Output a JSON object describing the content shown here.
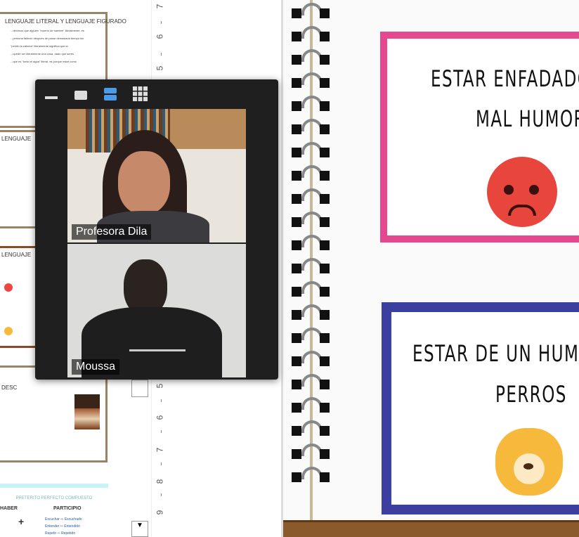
{
  "document": {
    "slide1_title": "LENGUAJE LITERAL Y LENGUAJE FIGURADO",
    "slide1_lines": [
      "...decimos que alguien \"muerto de hambre\" literalmente, es",
      "...persona falleció después de pasar demasiado tiempo sin",
      "\"perdió la cabeza\" literalmente significa que la",
      "...quede ser literalmente una cosa, dado que seres",
      "...que es \"tonto el agua\" literal, es porque estar como"
    ],
    "slide2_title": "LENGUAJE",
    "slide3_title": "LENGUAJE",
    "slide4_title": "DESC",
    "slide5_title": "PRETERITO PERFECTO COMPUESTO",
    "slide5_left_header": "HABER",
    "slide5_plus": "+",
    "slide5_right_header": "PARTICIPIO",
    "slide5_verbs": [
      {
        "inf": "Escuchar",
        "part": "Escuchado"
      },
      {
        "inf": "Entender",
        "part": "Entendido"
      },
      {
        "inf": "Repetir",
        "part": "Repetido"
      }
    ]
  },
  "ruler": {
    "top": [
      "7",
      "6",
      "5"
    ],
    "bottom": [
      "5",
      "6",
      "7",
      "8",
      "9"
    ]
  },
  "video_call": {
    "toolbar_icons": [
      "minimize-icon",
      "single-view-icon",
      "speaker-view-icon",
      "gallery-view-icon"
    ],
    "participants": [
      {
        "name": "Profesora Dila"
      },
      {
        "name": "Moussa"
      }
    ]
  },
  "cards": [
    {
      "lines": [
        "ESTAR ENFADADO",
        "MAL HUMOR"
      ],
      "emoji": "😡",
      "border": "#e4488f"
    },
    {
      "lines": [
        "ESTAR DE UN HUM",
        "PERROS"
      ],
      "emoji": "🐶",
      "border": "#3b3fa0"
    }
  ]
}
